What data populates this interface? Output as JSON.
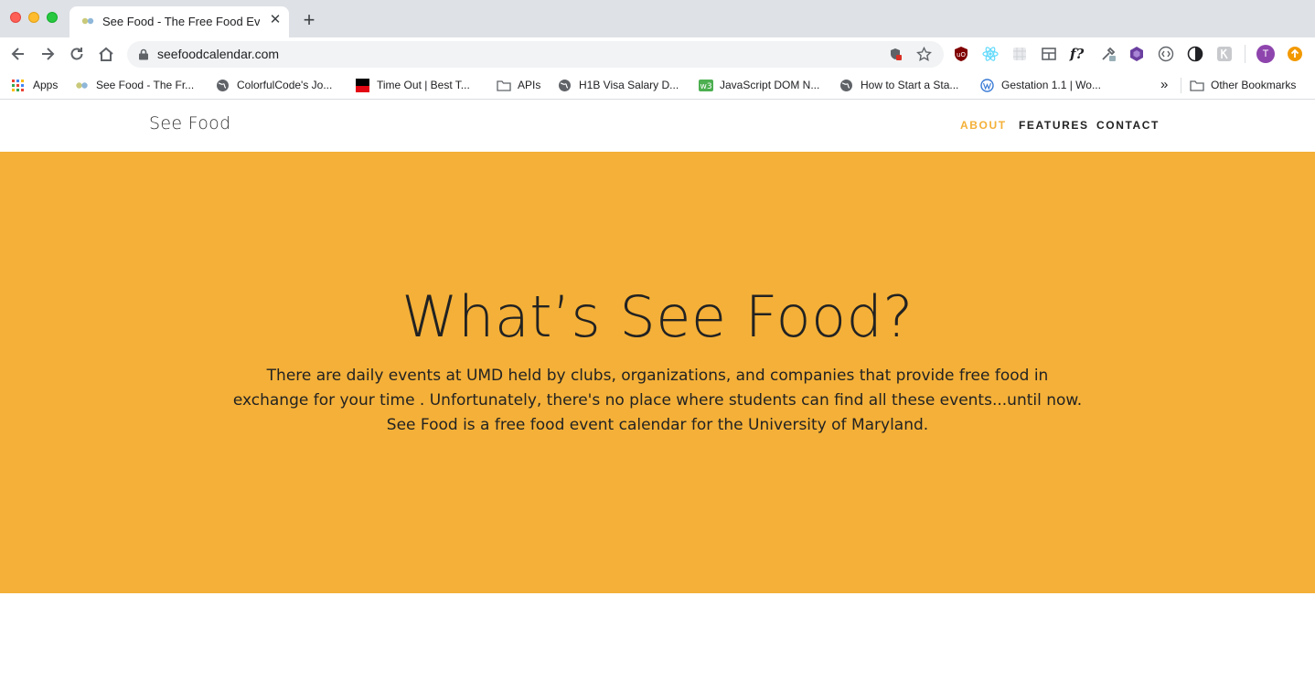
{
  "browser": {
    "tab_title": "See Food - The Free Food Event Calendar",
    "new_tab_symbol": "+",
    "close_symbol": "✕",
    "url": "seefoodcalendar.com",
    "profile_initial": "T",
    "extension_badge_text": "f?",
    "bookmarks": [
      {
        "label": "Apps",
        "icon": "apps-grid-icon"
      },
      {
        "label": "See Food - The Fr...",
        "icon": "seefood-favicon-icon"
      },
      {
        "label": "ColorfulCode's Jo...",
        "icon": "globe-icon"
      },
      {
        "label": "Time Out | Best T...",
        "icon": "timeout-favicon-icon"
      },
      {
        "label": "APIs",
        "icon": "folder-icon"
      },
      {
        "label": "H1B Visa Salary D...",
        "icon": "globe-icon"
      },
      {
        "label": "JavaScript DOM N...",
        "icon": "w3-favicon-icon"
      },
      {
        "label": "How to Start a Sta...",
        "icon": "globe-icon"
      },
      {
        "label": "Gestation 1.1 | Wo...",
        "icon": "wordpress-icon"
      }
    ],
    "overflow_symbol": "»",
    "other_bookmarks": "Other Bookmarks"
  },
  "site": {
    "brand": "See Food",
    "nav": [
      {
        "label": "ABOUT",
        "active": true
      },
      {
        "label": "FEATURES",
        "active": false
      },
      {
        "label": "CONTACT",
        "active": false
      }
    ],
    "hero": {
      "title": "What’s See Food?",
      "text": "There are daily events at UMD held by clubs, organizations, and companies that provide free food in exchange for your time . Unfortunately, there's no place where students can find all these events...until now. See Food is a free food event calendar for the University of Maryland."
    }
  },
  "colors": {
    "accent": "#f4b038",
    "text_dark": "#222222",
    "chrome_bg": "#dee1e6",
    "profile": "#8e44ad"
  }
}
